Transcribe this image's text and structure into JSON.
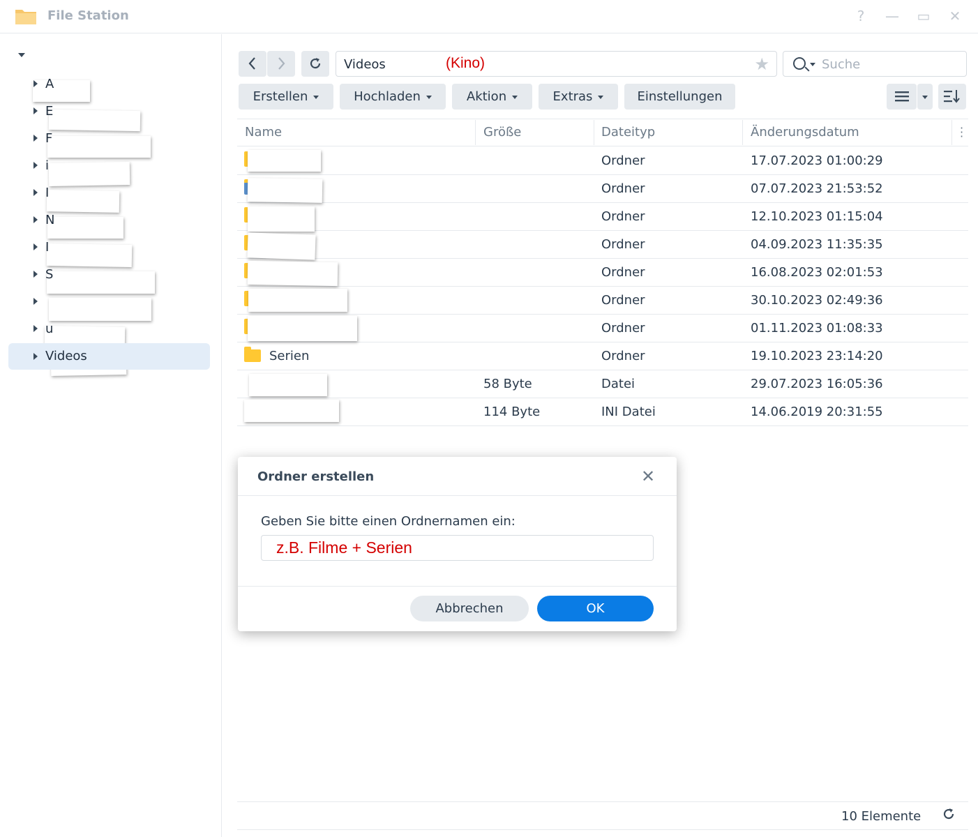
{
  "window": {
    "title": "File Station",
    "controls": [
      "?",
      "—",
      "▭",
      "✕"
    ]
  },
  "sidebar": {
    "items": [
      {
        "label": "",
        "fragment": "",
        "expanded": true
      },
      {
        "label": "",
        "fragment": "A"
      },
      {
        "label": "",
        "fragment": "E"
      },
      {
        "label": "",
        "fragment": "F"
      },
      {
        "label": "",
        "fragment": "i"
      },
      {
        "label": "",
        "fragment": "I"
      },
      {
        "label": "",
        "fragment": "N"
      },
      {
        "label": "",
        "fragment": "I"
      },
      {
        "label": "",
        "fragment": "S"
      },
      {
        "label": "",
        "fragment": ""
      },
      {
        "label": "",
        "fragment": "u"
      },
      {
        "label": "Videos",
        "fragment": "",
        "selected": true
      }
    ]
  },
  "toolbar": {
    "path": "Videos",
    "path_note": "(Kino)",
    "search_placeholder": "Suche",
    "buttons": [
      "Erstellen",
      "Hochladen",
      "Aktion",
      "Extras",
      "Einstellungen"
    ]
  },
  "table": {
    "columns": [
      "Name",
      "Größe",
      "Dateityp",
      "Änderungsdatum"
    ],
    "rows": [
      {
        "name": "",
        "size": "",
        "type": "Ordner",
        "date": "17.07.2023 01:00:29"
      },
      {
        "name": "",
        "size": "",
        "type": "Ordner",
        "date": "07.07.2023 21:53:52"
      },
      {
        "name": "",
        "size": "",
        "type": "Ordner",
        "date": "12.10.2023 01:15:04"
      },
      {
        "name": "",
        "size": "",
        "type": "Ordner",
        "date": "04.09.2023 11:35:35"
      },
      {
        "name": "",
        "size": "",
        "type": "Ordner",
        "date": "16.08.2023 02:01:53"
      },
      {
        "name": "",
        "size": "",
        "type": "Ordner",
        "date": "30.10.2023 02:49:36"
      },
      {
        "name": "",
        "size": "",
        "type": "Ordner",
        "date": "01.11.2023 01:08:33"
      },
      {
        "name": "Serien",
        "size": "",
        "type": "Ordner",
        "date": "19.10.2023 23:14:20"
      },
      {
        "name": "",
        "size": "58 Byte",
        "type": "Datei",
        "date": "29.07.2023 16:05:36"
      },
      {
        "name": "",
        "size": "114 Byte",
        "type": "INI Datei",
        "date": "14.06.2019 20:31:55"
      }
    ]
  },
  "footer": {
    "count": "10 Elemente"
  },
  "dialog": {
    "title": "Ordner erstellen",
    "prompt": "Geben Sie bitte einen Ordnernamen ein:",
    "input_value": "z.B. Filme + Serien",
    "cancel_label": "Abbrechen",
    "ok_label": "OK"
  },
  "colors": {
    "accent": "#0a7ce5",
    "annotation_red": "#d40000",
    "folder": "#ffc832",
    "selected_bg": "#e3edf8"
  }
}
